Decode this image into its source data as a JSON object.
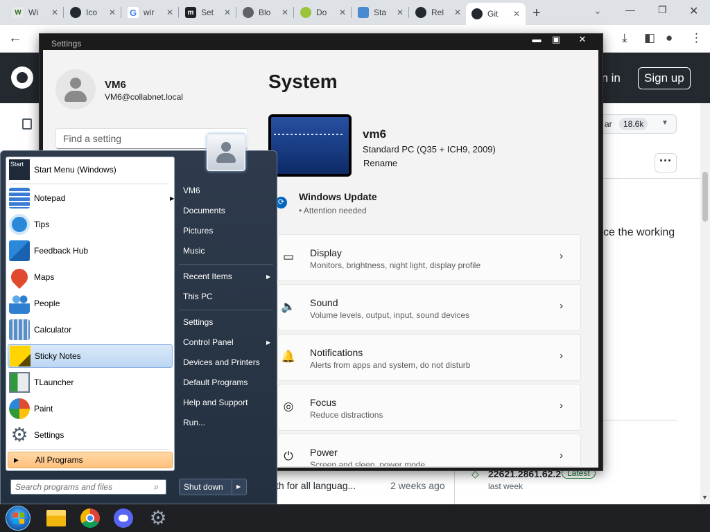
{
  "browser": {
    "tabs": [
      {
        "label": "Wi",
        "icon": "wiki-icon",
        "color": "#e8e8e8",
        "glyph": "W"
      },
      {
        "label": "Ico",
        "icon": "github-icon",
        "color": "#24292f",
        "glyph": ""
      },
      {
        "label": "wir",
        "icon": "google-icon",
        "color": "#4285f4",
        "glyph": "G"
      },
      {
        "label": "Set",
        "icon": "building-icon",
        "color": "#202124",
        "glyph": "m"
      },
      {
        "label": "Blo",
        "icon": "globe-icon",
        "color": "#5f6368",
        "glyph": ""
      },
      {
        "label": "Do",
        "icon": "chrome-ext-icon",
        "color": "#9ac43a",
        "glyph": ""
      },
      {
        "label": "Sta",
        "icon": "doc-icon",
        "color": "#4a8ad0",
        "glyph": ""
      },
      {
        "label": "Rel",
        "icon": "github-icon",
        "color": "#24292f",
        "glyph": ""
      },
      {
        "label": "Git",
        "icon": "github-icon",
        "color": "#24292f",
        "glyph": ""
      }
    ],
    "new_tab": "+",
    "tab_close": "✕"
  },
  "github": {
    "sign_in": "gn in",
    "sign_up": "Sign up",
    "star_label": "ar",
    "star_count": "18.6k",
    "text": "ce the working",
    "commit_msg": "th for all languag...",
    "commit_time": "2 weeks ago",
    "release": "22621.2861.62.2",
    "latest": "Latest",
    "last_week": "last week"
  },
  "settings": {
    "window_title": "Settings",
    "account_name": "VM6",
    "account_email": "VM6@collabnet.local",
    "search_placeholder": "Find a setting",
    "page_title": "System",
    "pc_name": "vm6",
    "pc_model": "Standard PC (Q35 + ICH9, 2009)",
    "rename": "Rename",
    "update_title": "Windows Update",
    "update_status": "Attention needed",
    "cards": [
      {
        "title": "Display",
        "subtitle": "Monitors, brightness, night light, display profile"
      },
      {
        "title": "Sound",
        "subtitle": "Volume levels, output, input, sound devices"
      },
      {
        "title": "Notifications",
        "subtitle": "Alerts from apps and system, do not disturb"
      },
      {
        "title": "Focus",
        "subtitle": "Reduce distractions"
      },
      {
        "title": "Power",
        "subtitle": "Screen and sleep, power mode"
      }
    ]
  },
  "start_menu": {
    "programs": [
      {
        "label": "Start Menu (Windows)",
        "icon": "start-menu-app-icon"
      },
      {
        "label": "Notepad",
        "icon": "notepad-icon"
      },
      {
        "label": "Tips",
        "icon": "tips-bulb-icon"
      },
      {
        "label": "Feedback Hub",
        "icon": "feedback-icon"
      },
      {
        "label": "Maps",
        "icon": "maps-pin-icon"
      },
      {
        "label": "People",
        "icon": "people-icon"
      },
      {
        "label": "Calculator",
        "icon": "calculator-icon"
      },
      {
        "label": "Sticky Notes",
        "icon": "sticky-notes-icon"
      },
      {
        "label": "TLauncher",
        "icon": "tlauncher-icon"
      },
      {
        "label": "Paint",
        "icon": "paint-icon"
      },
      {
        "label": "Settings",
        "icon": "gear-icon"
      }
    ],
    "all_programs": "All Programs",
    "search_placeholder": "Search programs and files",
    "right_links": [
      {
        "label": "VM6"
      },
      {
        "label": "Documents"
      },
      {
        "label": "Pictures"
      },
      {
        "label": "Music"
      },
      {
        "label": "Recent Items"
      },
      {
        "label": "This PC"
      },
      {
        "label": "Settings"
      },
      {
        "label": "Control Panel"
      },
      {
        "label": "Devices and Printers"
      },
      {
        "label": "Default Programs"
      },
      {
        "label": "Help and Support"
      },
      {
        "label": "Run..."
      }
    ],
    "shut_down": "Shut down",
    "start_label": "Start"
  },
  "taskbar": {
    "apps": [
      {
        "icon": "file-explorer-icon"
      },
      {
        "icon": "chrome-icon"
      },
      {
        "icon": "discord-icon"
      },
      {
        "icon": "settings-gear-icon"
      }
    ]
  }
}
